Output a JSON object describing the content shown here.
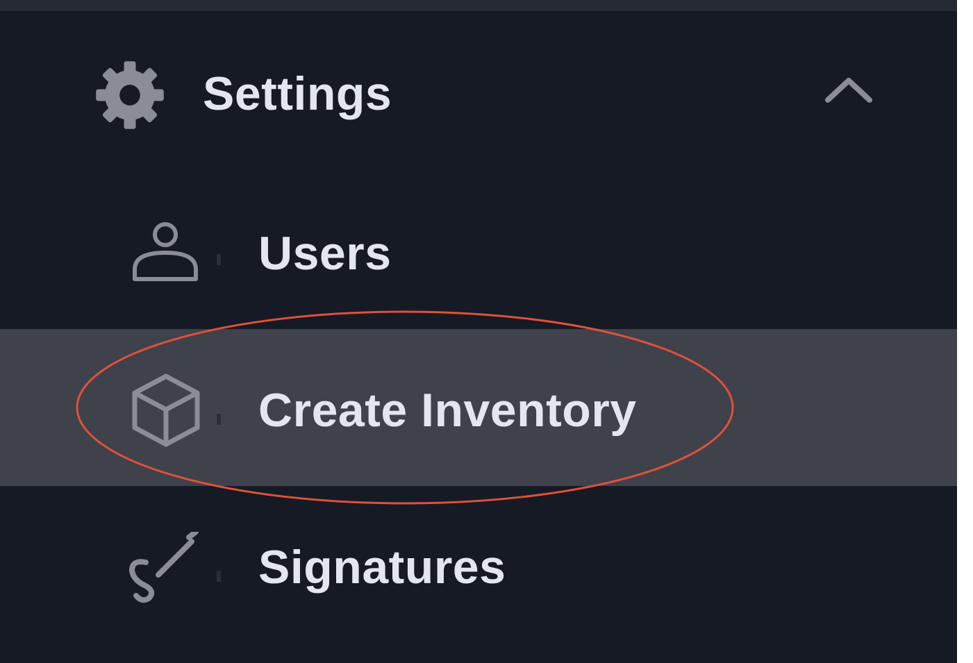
{
  "sidebar": {
    "settings": {
      "label": "Settings",
      "icon": "gear-icon",
      "expanded": true
    },
    "items": [
      {
        "label": "Users",
        "icon": "user-icon"
      },
      {
        "label": "Create Inventory",
        "icon": "cube-icon",
        "active": true
      },
      {
        "label": "Signatures",
        "icon": "signature-icon"
      }
    ]
  },
  "colors": {
    "background": "#161a24",
    "active_row": "#3f424a",
    "text": "#e3e6ee",
    "icon": "#8a8d95",
    "annotation": "#e0513a"
  }
}
